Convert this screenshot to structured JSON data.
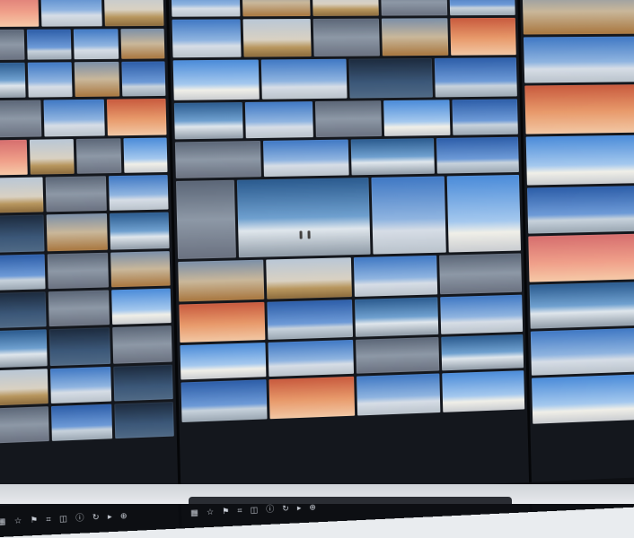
{
  "screen": {
    "panels": [
      {
        "id": "left-gallery"
      },
      {
        "id": "middle-gallery"
      },
      {
        "id": "right-gallery"
      }
    ]
  },
  "toolbar": {
    "icons": [
      "grid-icon",
      "star-icon",
      "flag-icon",
      "crop-icon",
      "compare-icon",
      "info-icon",
      "rotate-icon",
      "play-icon",
      "zoom-icon"
    ]
  }
}
